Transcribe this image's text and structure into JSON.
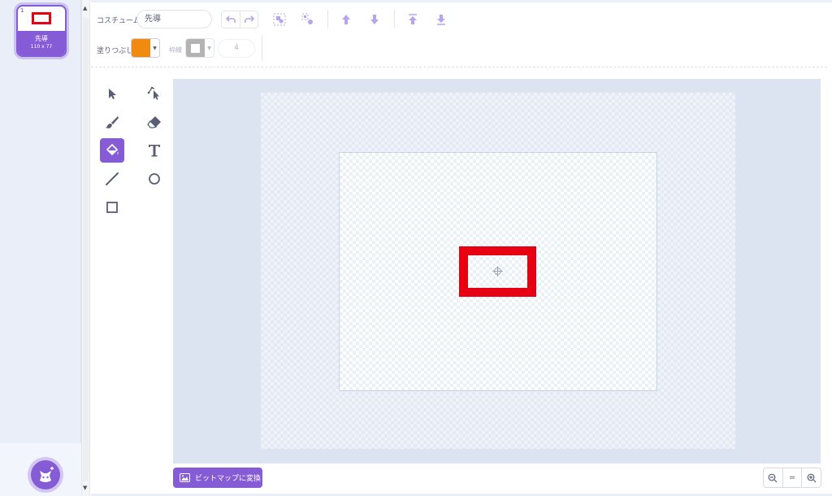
{
  "costume_list": {
    "items": [
      {
        "number": "1",
        "name": "先導",
        "size": "110 x 77"
      }
    ]
  },
  "toolbar": {
    "costume_label": "コスチューム",
    "costume_name": "先導",
    "fill_label": "塗りつぶし",
    "fill_color": "#f08a11",
    "stroke_label": "枠線",
    "stroke_width": "4"
  },
  "canvas": {
    "shape_stroke_color": "#e60012"
  },
  "bottom": {
    "convert_button": "ビットマップに変換",
    "zoom_reset": "="
  },
  "theme": {
    "accent": "#855cd6",
    "icon_light": "#b8a4ea"
  }
}
